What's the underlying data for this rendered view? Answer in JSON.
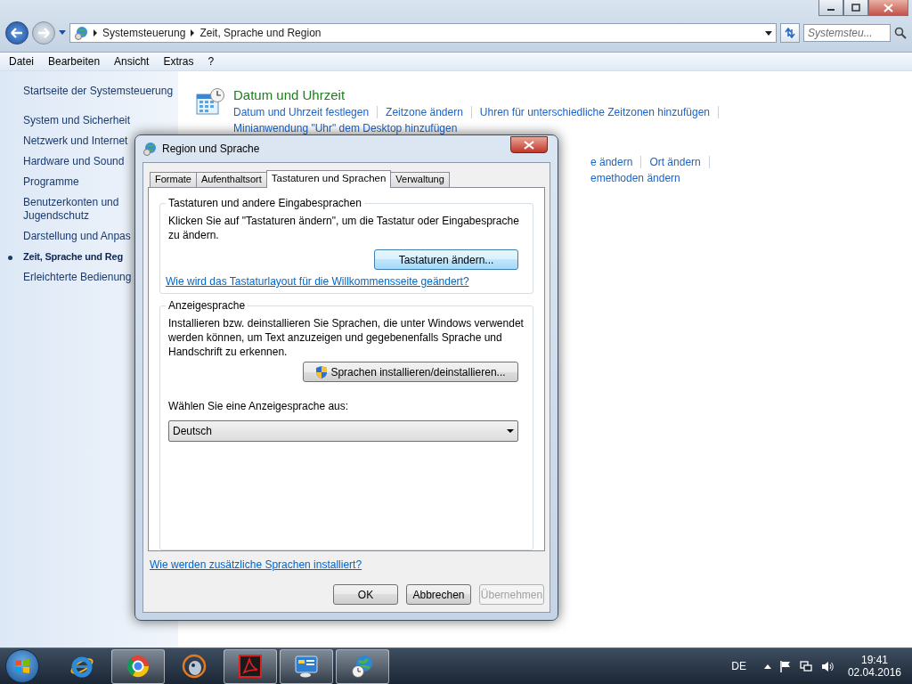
{
  "address_bar": {
    "breadcrumbs": [
      "Systemsteuerung",
      "Zeit, Sprache und Region"
    ],
    "search_placeholder": "Systemsteu..."
  },
  "menu": [
    "Datei",
    "Bearbeiten",
    "Ansicht",
    "Extras",
    "?"
  ],
  "sidebar": {
    "home": "Startseite der Systemsteuerung",
    "items": [
      {
        "label": "System und Sicherheit",
        "selected": false
      },
      {
        "label": "Netzwerk und Internet",
        "selected": false
      },
      {
        "label": "Hardware und Sound",
        "selected": false
      },
      {
        "label": "Programme",
        "selected": false
      },
      {
        "label": "Benutzerkonten und Jugendschutz",
        "selected": false
      },
      {
        "label": "Darstellung und Anpas",
        "selected": false
      },
      {
        "label": "Zeit, Sprache und Reg",
        "selected": true
      },
      {
        "label": "Erleichterte Bedienung",
        "selected": false
      }
    ]
  },
  "sections": [
    {
      "title": "Datum und Uhrzeit",
      "lines": [
        [
          "Datum und Uhrzeit festlegen",
          "Zeitzone ändern",
          "Uhren für unterschiedliche Zeitzonen hinzufügen"
        ],
        [
          "Minianwendung \"Uhr\" dem Desktop hinzufügen"
        ]
      ]
    },
    {
      "lines": [
        [
          "e ändern",
          "Ort ändern"
        ],
        [
          "emethoden ändern"
        ]
      ]
    }
  ],
  "dialog": {
    "title": "Region und Sprache",
    "tabs": [
      {
        "label": "Formate",
        "selected": false
      },
      {
        "label": "Aufenthaltsort",
        "selected": false
      },
      {
        "label": "Tastaturen und Sprachen",
        "selected": true
      },
      {
        "label": "Verwaltung",
        "selected": false
      }
    ],
    "keyboard_group": {
      "legend": "Tastaturen und andere Eingabesprachen",
      "text": "Klicken Sie auf \"Tastaturen ändern\", um die Tastatur oder Eingabesprache zu ändern.",
      "button": "Tastaturen ändern...",
      "link": "Wie wird das Tastaturlayout für die Willkommensseite geändert?"
    },
    "display_group": {
      "legend": "Anzeigesprache",
      "text": "Installieren bzw. deinstallieren Sie Sprachen, die unter Windows verwendet werden können, um Text anzuzeigen und gegebenenfalls Sprache und Handschrift zu erkennen.",
      "button": "Sprachen installieren/deinstallieren...",
      "select_label": "Wählen Sie eine Anzeigesprache aus:",
      "select_value": "Deutsch"
    },
    "footer_link": "Wie werden zusätzliche Sprachen installiert?",
    "buttons": [
      {
        "label": "OK",
        "disabled": false
      },
      {
        "label": "Abbrechen",
        "disabled": false
      },
      {
        "label": "Übernehmen",
        "disabled": true
      }
    ]
  },
  "taskbar": {
    "apps": [
      {
        "kind": "e-letter",
        "running": false
      },
      {
        "kind": "ring",
        "running": true
      },
      {
        "kind": "creature",
        "running": false
      },
      {
        "kind": "document",
        "running": true
      },
      {
        "kind": "monitor",
        "running": true
      },
      {
        "kind": "globe",
        "running": true
      }
    ],
    "language": "DE",
    "time": "19:41",
    "date": "02.04.2016"
  }
}
